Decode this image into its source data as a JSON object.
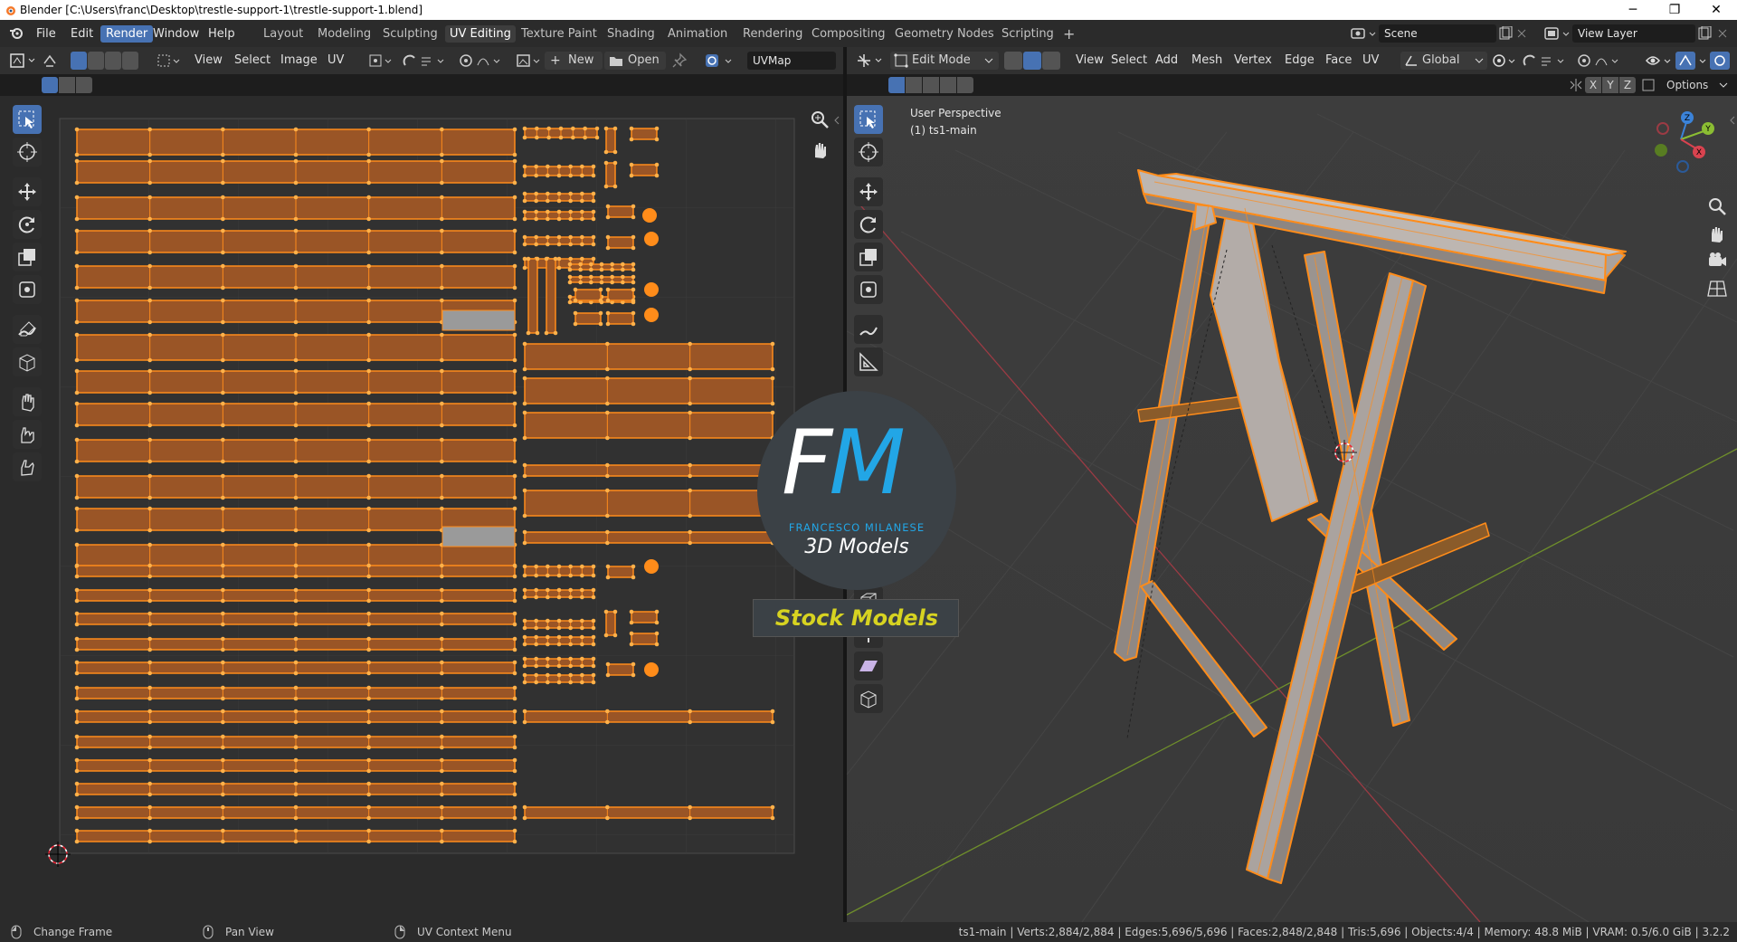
{
  "window": {
    "title": "Blender [C:\\Users\\franc\\Desktop\\trestle-support-1\\trestle-support-1.blend]",
    "minimize": "─",
    "maximize": "❐",
    "close": "✕"
  },
  "menu": {
    "items": [
      "File",
      "Edit",
      "Render",
      "Window",
      "Help"
    ],
    "active": "Render"
  },
  "workspaces": {
    "tabs": [
      "Layout",
      "Modeling",
      "Sculpting",
      "UV Editing",
      "Texture Paint",
      "Shading",
      "Animation",
      "Rendering",
      "Compositing",
      "Geometry Nodes",
      "Scripting"
    ],
    "active": "UV Editing",
    "add": "+"
  },
  "scene": {
    "name": "Scene",
    "view_layer": "View Layer"
  },
  "uv_editor": {
    "menus": [
      "View",
      "Select",
      "Image",
      "UV"
    ],
    "new_label": "New",
    "open_label": "Open",
    "uvmap": "UVMap"
  },
  "viewport": {
    "mode": "Edit Mode",
    "menus": [
      "View",
      "Select",
      "Add",
      "Mesh",
      "Vertex",
      "Edge",
      "Face",
      "UV"
    ],
    "orientation": "Global",
    "axes": [
      "X",
      "Y",
      "Z"
    ],
    "options": "Options",
    "overlay_title": "User Perspective",
    "overlay_object": "(1) ts1-main",
    "gizmo_axes": {
      "z": "Z",
      "y": "Y",
      "x": "X"
    }
  },
  "watermark": {
    "letters": "FM",
    "name": "FRANCESCO MILANESE",
    "subtitle": "3D Models",
    "badge": "Stock Models"
  },
  "status": {
    "left": [
      {
        "icon": "mouse-left-icon",
        "label": "Change Frame"
      },
      {
        "icon": "mouse-middle-icon",
        "label": "Pan View"
      },
      {
        "icon": "mouse-right-icon",
        "label": "UV Context Menu"
      }
    ],
    "stats": "ts1-main | Verts:2,884/2,884 | Edges:5,696/5,696 | Faces:2,848/2,848 | Tris:5,696 | Objects:4/4 | Memory: 48.8 MiB | VRAM: 0.5/6.0 GiB | 3.2.2"
  },
  "colors": {
    "accent": "#4772b3",
    "selection": "#ff8c1a",
    "uv_face": "#9a5526",
    "x_axis": "#d9434f",
    "y_axis": "#8bbd33",
    "z_axis": "#3b83d9"
  }
}
